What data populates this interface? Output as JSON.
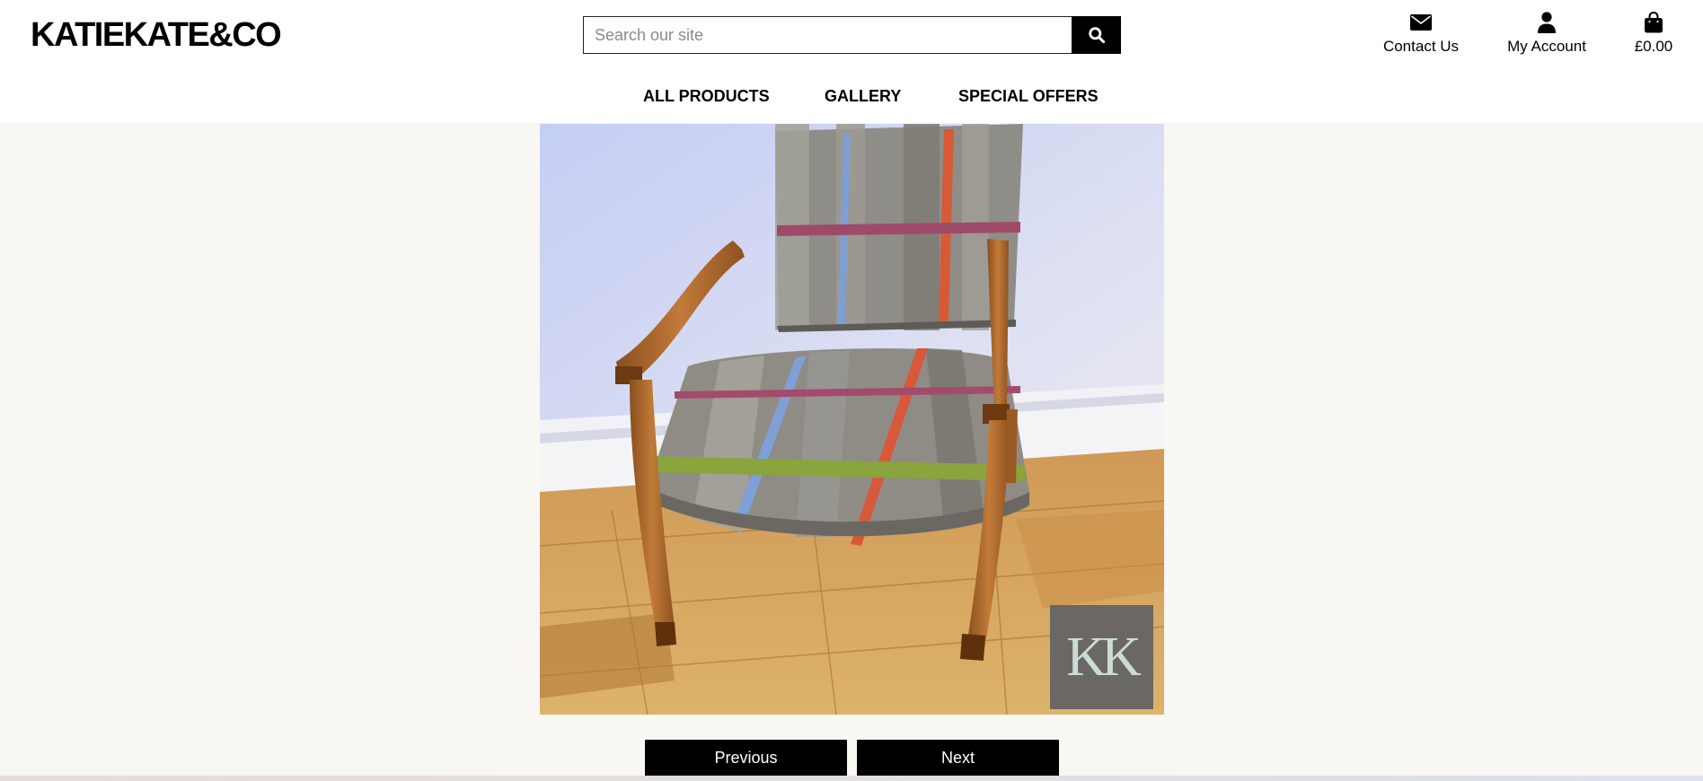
{
  "brand": {
    "logo_text": "KATIEKATE&CO"
  },
  "search": {
    "placeholder": "Search our site",
    "value": "",
    "icon": "search-icon"
  },
  "utility_nav": {
    "contact_label": "Contact Us",
    "contact_icon": "envelope-icon",
    "account_label": "My Account",
    "account_icon": "user-icon",
    "bag_total": "£0.00",
    "bag_icon": "shopping-bag-icon"
  },
  "main_nav": {
    "items": [
      {
        "label": "ALL PRODUCTS"
      },
      {
        "label": "GALLERY"
      },
      {
        "label": "SPECIAL OFFERS"
      }
    ]
  },
  "gallery": {
    "image_subject": "wooden armchair upholstered in grey tartan wool",
    "watermark_text": "KK",
    "previous_label": "Previous",
    "next_label": "Next"
  },
  "colors": {
    "page_background": "#f9f7f3",
    "header_background": "#ffffff",
    "button_background": "#000000",
    "button_text": "#ffffff"
  }
}
